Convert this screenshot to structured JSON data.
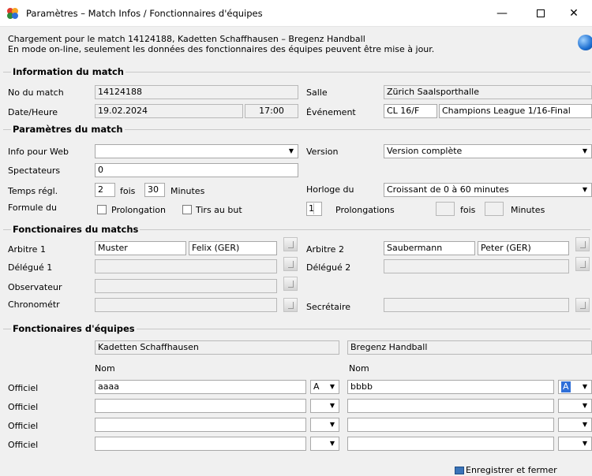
{
  "window": {
    "title": "Paramètres – Match Infos / Fonctionnaires d'équipes",
    "min": "—",
    "close": "✕"
  },
  "info": {
    "line1": "Chargement pour le match 14124188, Kadetten Schaffhausen – Bregenz Handball",
    "line2": "En mode on-line, seulement les données des fonctionnaires des équipes peuvent être mise à jour."
  },
  "sections": {
    "match_info": "Information du match",
    "match_params": "Paramètres du match",
    "match_officials": "Fonctionaires du matchs",
    "team_officials": "Fonctionaires d'équipes"
  },
  "match_info": {
    "no_label": "No du match",
    "no_value": "14124188",
    "salle_label": "Salle",
    "salle_value": "Zürich Saalsporthalle",
    "date_label": "Date/Heure",
    "date_value": "19.02.2024",
    "time_value": "17:00",
    "event_label": "Événement",
    "event_code": "CL 16/F",
    "event_name": "Champions League 1/16-Final"
  },
  "params": {
    "web_label": "Info pour Web",
    "web_value": "",
    "version_label": "Version",
    "version_value": "Version complète",
    "spect_label": "Spectateurs",
    "spect_value": "0",
    "temps_label": "Temps régl.",
    "temps_count": "2",
    "fois": "fois",
    "temps_minutes": "30",
    "minutes": "Minutes",
    "horloge_label": "Horloge du",
    "horloge_value": "Croissant de 0 à 60 minutes",
    "formule_label": "Formule du",
    "prolongation": "Prolongation",
    "tirs": "Tirs au but",
    "prolong_count": "1",
    "prolongations": "Prolongations",
    "fois2": "fois",
    "minutes2": "Minutes"
  },
  "officials": {
    "arbitre1_label": "Arbitre 1",
    "arbitre1_last": "Muster",
    "arbitre1_first": "Felix (GER)",
    "arbitre2_label": "Arbitre 2",
    "arbitre2_last": "Saubermann",
    "arbitre2_first": "Peter (GER)",
    "delegue1_label": "Délégué 1",
    "delegue2_label": "Délégué 2",
    "observateur_label": "Observateur",
    "chrono_label": "Chronométr",
    "secretaire_label": "Secrétaire"
  },
  "teams": {
    "home": "Kadetten Schaffhausen",
    "away": "Bregenz Handball",
    "nom": "Nom",
    "rows": [
      {
        "label": "Officiel",
        "home_name": "aaaa",
        "home_code": "A",
        "away_name": "bbbb",
        "away_code": "A"
      },
      {
        "label": "Officiel",
        "home_name": "",
        "home_code": "",
        "away_name": "",
        "away_code": ""
      },
      {
        "label": "Officiel",
        "home_name": "",
        "home_code": "",
        "away_name": "",
        "away_code": ""
      },
      {
        "label": "Officiel",
        "home_name": "",
        "home_code": "",
        "away_name": "",
        "away_code": ""
      }
    ]
  },
  "footer": {
    "save_label": "Enregistrer et fermer"
  }
}
